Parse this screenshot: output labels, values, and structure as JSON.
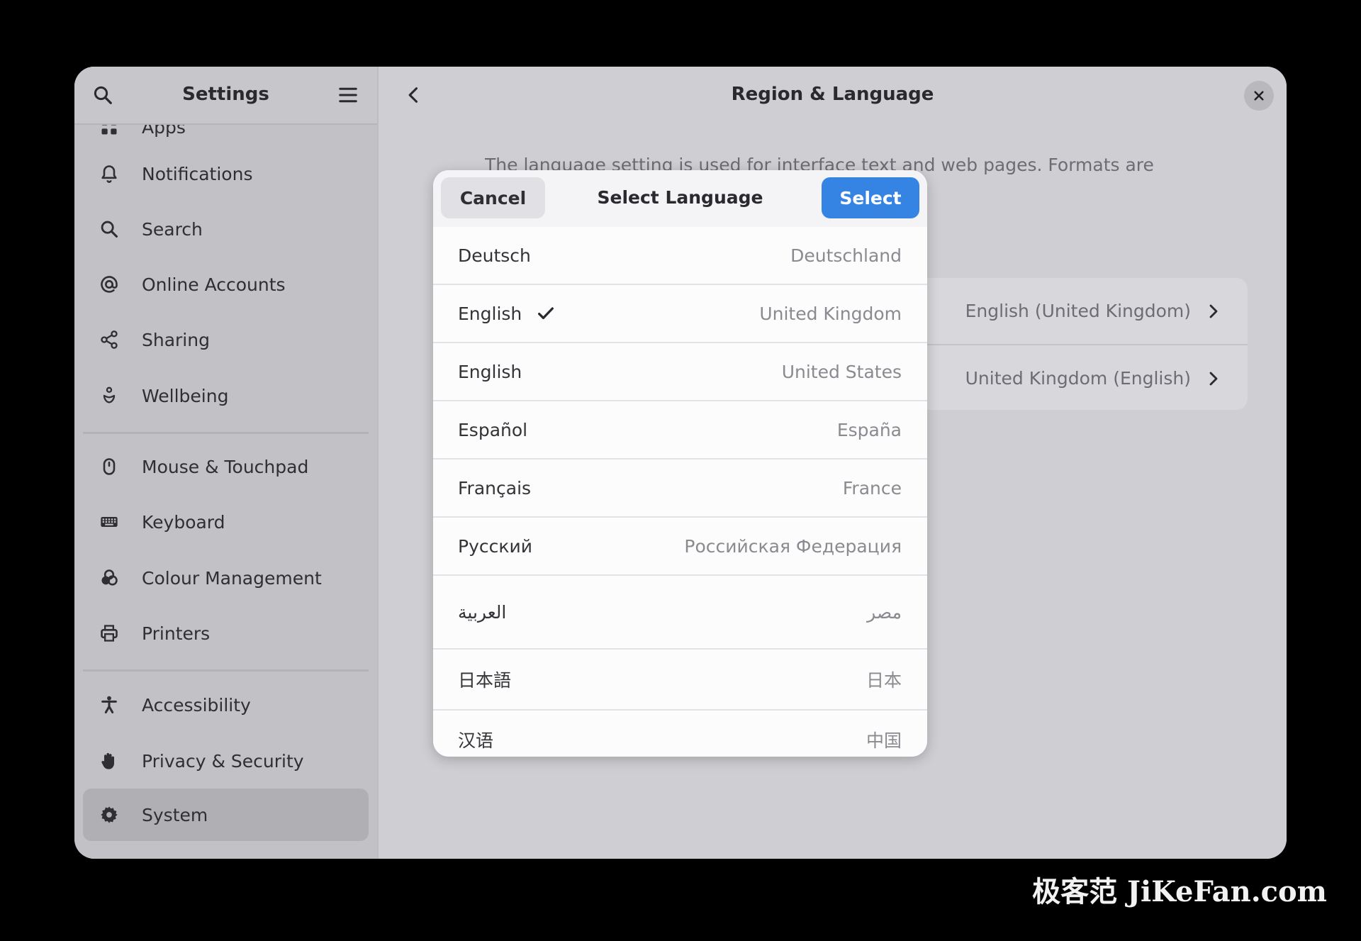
{
  "sidebar": {
    "title": "Settings",
    "items": [
      {
        "label": "Apps",
        "icon": "apps-icon"
      },
      {
        "label": "Notifications",
        "icon": "bell-icon"
      },
      {
        "label": "Search",
        "icon": "search-icon"
      },
      {
        "label": "Online Accounts",
        "icon": "at-icon"
      },
      {
        "label": "Sharing",
        "icon": "share-icon"
      },
      {
        "label": "Wellbeing",
        "icon": "wellbeing-icon"
      },
      {
        "label": "Mouse & Touchpad",
        "icon": "mouse-icon"
      },
      {
        "label": "Keyboard",
        "icon": "keyboard-icon"
      },
      {
        "label": "Colour Management",
        "icon": "colour-icon"
      },
      {
        "label": "Printers",
        "icon": "printer-icon"
      },
      {
        "label": "Accessibility",
        "icon": "accessibility-icon"
      },
      {
        "label": "Privacy & Security",
        "icon": "hand-icon"
      },
      {
        "label": "System",
        "icon": "gear-icon",
        "active": true
      }
    ]
  },
  "main": {
    "title": "Region & Language",
    "description": "The language setting is used for interface text and web pages. Formats are",
    "rows": [
      {
        "value": "English (United Kingdom)"
      },
      {
        "value": "United Kingdom (English)"
      }
    ]
  },
  "dialog": {
    "title": "Select Language",
    "cancel_label": "Cancel",
    "select_label": "Select",
    "languages": [
      {
        "name": "Deutsch",
        "region": "Deutschland",
        "selected": false
      },
      {
        "name": "English",
        "region": "United Kingdom",
        "selected": true
      },
      {
        "name": "English",
        "region": "United States",
        "selected": false
      },
      {
        "name": "Español",
        "region": "España",
        "selected": false
      },
      {
        "name": "Français",
        "region": "France",
        "selected": false
      },
      {
        "name": "Русский",
        "region": "Российская Федерация",
        "selected": false
      },
      {
        "name": "العربية",
        "region": "مصر",
        "selected": false
      },
      {
        "name": "日本語",
        "region": "日本",
        "selected": false
      },
      {
        "name": "汉语",
        "region": "中国",
        "selected": false
      }
    ]
  },
  "watermark": "极客范 JiKeFan.com",
  "colors": {
    "accent": "#3584e4",
    "window_bg": "#cfcfd3",
    "sidebar_bg": "#c2c2c6"
  }
}
